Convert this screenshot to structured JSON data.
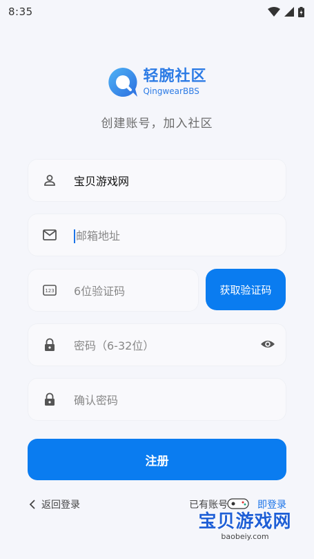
{
  "status_bar": {
    "time": "8:35"
  },
  "logo": {
    "name_cn": "轻腕社区",
    "name_en": "QingwearBBS"
  },
  "tagline": "创建账号，加入社区",
  "form": {
    "username": {
      "value": "宝贝游戏网",
      "icon": "user-icon"
    },
    "email": {
      "placeholder": "邮箱地址",
      "icon": "mail-icon"
    },
    "code": {
      "placeholder": "6位验证码",
      "icon": "pin-code-icon"
    },
    "get_code_label": "获取验证码",
    "password": {
      "placeholder": "密码（6-32位）",
      "icon": "lock-icon"
    },
    "confirm_password": {
      "placeholder": "确认密码",
      "icon": "lock-icon"
    },
    "register_label": "注册"
  },
  "footer": {
    "back_label": "返回登录",
    "have_account_prefix": "已有账号",
    "login_link": "即登录"
  },
  "watermark": {
    "text_cn": "宝贝游戏网",
    "text_en": "baobeiy.com"
  },
  "colors": {
    "primary": "#0a7cf0",
    "background": "#f5f6fb",
    "logo": "#2c7be5"
  }
}
